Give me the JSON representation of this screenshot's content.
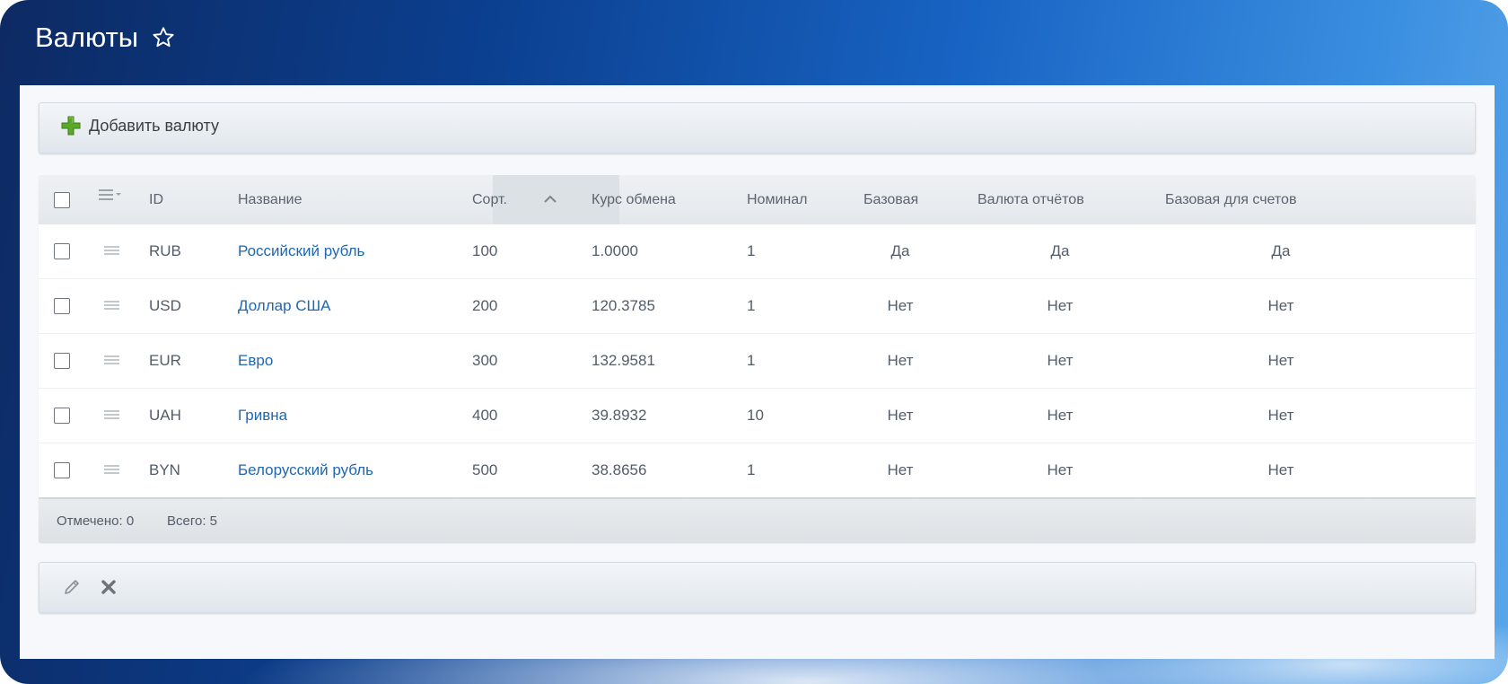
{
  "page": {
    "title": "Валюты"
  },
  "toolbar": {
    "add_label": "Добавить валюту"
  },
  "table": {
    "columns": {
      "id": "ID",
      "name": "Название",
      "sort": "Сорт.",
      "rate": "Курс обмена",
      "nominal": "Номинал",
      "base": "Базовая",
      "report": "Валюта отчётов",
      "invoice": "Базовая для счетов"
    },
    "rows": [
      {
        "id": "RUB",
        "name": "Российский рубль",
        "sort": "100",
        "rate": "1.0000",
        "nominal": "1",
        "base": "Да",
        "report": "Да",
        "invoice": "Да"
      },
      {
        "id": "USD",
        "name": "Доллар США",
        "sort": "200",
        "rate": "120.3785",
        "nominal": "1",
        "base": "Нет",
        "report": "Нет",
        "invoice": "Нет"
      },
      {
        "id": "EUR",
        "name": "Евро",
        "sort": "300",
        "rate": "132.9581",
        "nominal": "1",
        "base": "Нет",
        "report": "Нет",
        "invoice": "Нет"
      },
      {
        "id": "UAH",
        "name": "Гривна",
        "sort": "400",
        "rate": "39.8932",
        "nominal": "10",
        "base": "Нет",
        "report": "Нет",
        "invoice": "Нет"
      },
      {
        "id": "BYN",
        "name": "Белорусский рубль",
        "sort": "500",
        "rate": "38.8656",
        "nominal": "1",
        "base": "Нет",
        "report": "Нет",
        "invoice": "Нет"
      }
    ],
    "footer": {
      "selected": "Отмечено: 0",
      "total": "Всего: 5"
    }
  },
  "icons": {
    "star": "star-icon",
    "add": "plus-icon",
    "column_menu": "column-menu-icon",
    "row_menu": "row-menu-icon",
    "sort": "sort-ascending-icon",
    "edit": "pencil-icon",
    "delete": "close-icon"
  },
  "colors": {
    "link": "#2067b0",
    "add_icon": "#5aa82a",
    "header_bg": "#0b3f8f"
  }
}
